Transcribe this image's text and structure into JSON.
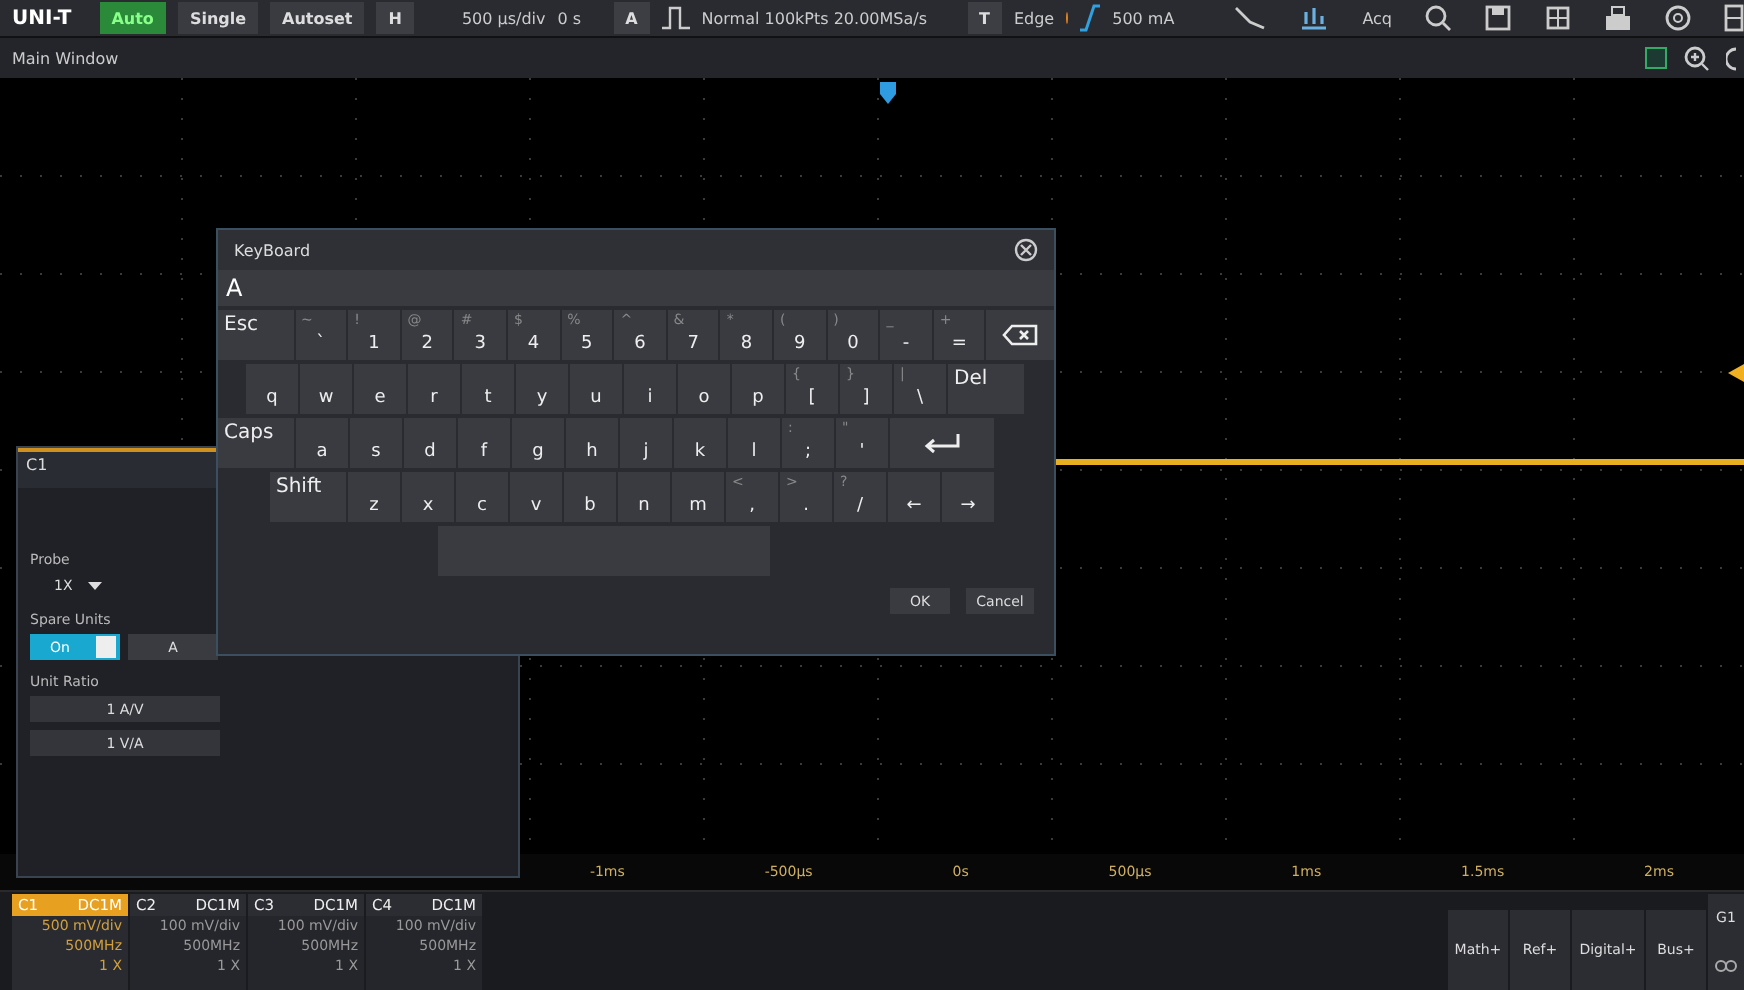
{
  "top_bar": {
    "logo": "UNI-T",
    "run_buttons": [
      {
        "label": "Auto",
        "active": true
      },
      {
        "label": "Single",
        "active": false
      },
      {
        "label": "Autoset",
        "active": false
      }
    ],
    "horizontal": {
      "label": "H",
      "scale": "500 μs/div",
      "offset": "0 s"
    },
    "acquisition": {
      "label": "A",
      "mode": "Normal  100kPts  20.00MSa/s"
    },
    "trigger": {
      "label": "T",
      "type": "Edge",
      "level": "500 mA"
    },
    "acq_label": "Acq"
  },
  "window_title": "Main Window",
  "time_axis": [
    "-1ms",
    "-500μs",
    "0s",
    "500μs",
    "1ms",
    "1.5ms",
    "2ms"
  ],
  "channel_panel": {
    "title": "C1",
    "probe_label": "Probe",
    "probe_value": "1X",
    "spare_units_label": "Spare Units",
    "spare_units_on": true,
    "spare_units_on_label": "On",
    "spare_unit": "A",
    "unit_ratio_label": "Unit Ratio",
    "unit_ratios": [
      "1 A/V",
      "1 V/A"
    ]
  },
  "keyboard": {
    "title": "KeyBoard",
    "value": "A",
    "rows": [
      {
        "keys": [
          {
            "kind": "special",
            "label": "Esc"
          },
          {
            "kind": "char",
            "shift": "~",
            "label": "`"
          },
          {
            "kind": "char",
            "shift": "!",
            "label": "1"
          },
          {
            "kind": "char",
            "shift": "@",
            "label": "2"
          },
          {
            "kind": "char",
            "shift": "#",
            "label": "3"
          },
          {
            "kind": "char",
            "shift": "$",
            "label": "4"
          },
          {
            "kind": "char",
            "shift": "%",
            "label": "5"
          },
          {
            "kind": "char",
            "shift": "^",
            "label": "6"
          },
          {
            "kind": "char",
            "shift": "&",
            "label": "7"
          },
          {
            "kind": "char",
            "shift": "*",
            "label": "8"
          },
          {
            "kind": "char",
            "shift": "(",
            "label": "9"
          },
          {
            "kind": "char",
            "shift": ")",
            "label": "0"
          },
          {
            "kind": "char",
            "shift": "_",
            "label": "-"
          },
          {
            "kind": "char",
            "shift": "+",
            "label": "="
          },
          {
            "kind": "backspace"
          }
        ]
      },
      {
        "keys": [
          {
            "kind": "char",
            "label": "q"
          },
          {
            "kind": "char",
            "label": "w"
          },
          {
            "kind": "char",
            "label": "e"
          },
          {
            "kind": "char",
            "label": "r"
          },
          {
            "kind": "char",
            "label": "t"
          },
          {
            "kind": "char",
            "label": "y"
          },
          {
            "kind": "char",
            "label": "u"
          },
          {
            "kind": "char",
            "label": "i"
          },
          {
            "kind": "char",
            "label": "o"
          },
          {
            "kind": "char",
            "label": "p"
          },
          {
            "kind": "char",
            "shift": "{",
            "label": "["
          },
          {
            "kind": "char",
            "shift": "}",
            "label": "]"
          },
          {
            "kind": "char",
            "shift": "|",
            "label": "\\"
          },
          {
            "kind": "special",
            "label": "Del"
          }
        ]
      },
      {
        "keys": [
          {
            "kind": "special",
            "label": "Caps"
          },
          {
            "kind": "char",
            "label": "a"
          },
          {
            "kind": "char",
            "label": "s"
          },
          {
            "kind": "char",
            "label": "d"
          },
          {
            "kind": "char",
            "label": "f"
          },
          {
            "kind": "char",
            "label": "g"
          },
          {
            "kind": "char",
            "label": "h"
          },
          {
            "kind": "char",
            "label": "j"
          },
          {
            "kind": "char",
            "label": "k"
          },
          {
            "kind": "char",
            "label": "l"
          },
          {
            "kind": "char",
            "shift": ":",
            "label": ";"
          },
          {
            "kind": "char",
            "shift": "\"",
            "label": "'"
          },
          {
            "kind": "enter"
          }
        ]
      },
      {
        "keys": [
          {
            "kind": "special",
            "label": "Shift"
          },
          {
            "kind": "char",
            "label": "z"
          },
          {
            "kind": "char",
            "label": "x"
          },
          {
            "kind": "char",
            "label": "c"
          },
          {
            "kind": "char",
            "label": "v"
          },
          {
            "kind": "char",
            "label": "b"
          },
          {
            "kind": "char",
            "label": "n"
          },
          {
            "kind": "char",
            "label": "m"
          },
          {
            "kind": "char",
            "shift": "<",
            "label": ","
          },
          {
            "kind": "char",
            "shift": ">",
            "label": "."
          },
          {
            "kind": "char",
            "shift": "?",
            "label": "/"
          },
          {
            "kind": "char",
            "label": "←"
          },
          {
            "kind": "char",
            "label": "→"
          }
        ]
      }
    ],
    "buttons": [
      "OK",
      "Cancel"
    ]
  },
  "channels": [
    {
      "name": "C1",
      "coupling": "DC1M",
      "scale": "500 mV/div",
      "bandwidth": "500MHz",
      "probe": "1 X",
      "selected": true
    },
    {
      "name": "C2",
      "coupling": "DC1M",
      "scale": "100 mV/div",
      "bandwidth": "500MHz",
      "probe": "1 X",
      "selected": false
    },
    {
      "name": "C3",
      "coupling": "DC1M",
      "scale": "100 mV/div",
      "bandwidth": "500MHz",
      "probe": "1 X",
      "selected": false
    },
    {
      "name": "C4",
      "coupling": "DC1M",
      "scale": "100 mV/div",
      "bandwidth": "500MHz",
      "probe": "1 X",
      "selected": false
    }
  ],
  "add_buttons": [
    "Math+",
    "Ref+",
    "Digital+",
    "Bus+"
  ],
  "side_label": "G1"
}
